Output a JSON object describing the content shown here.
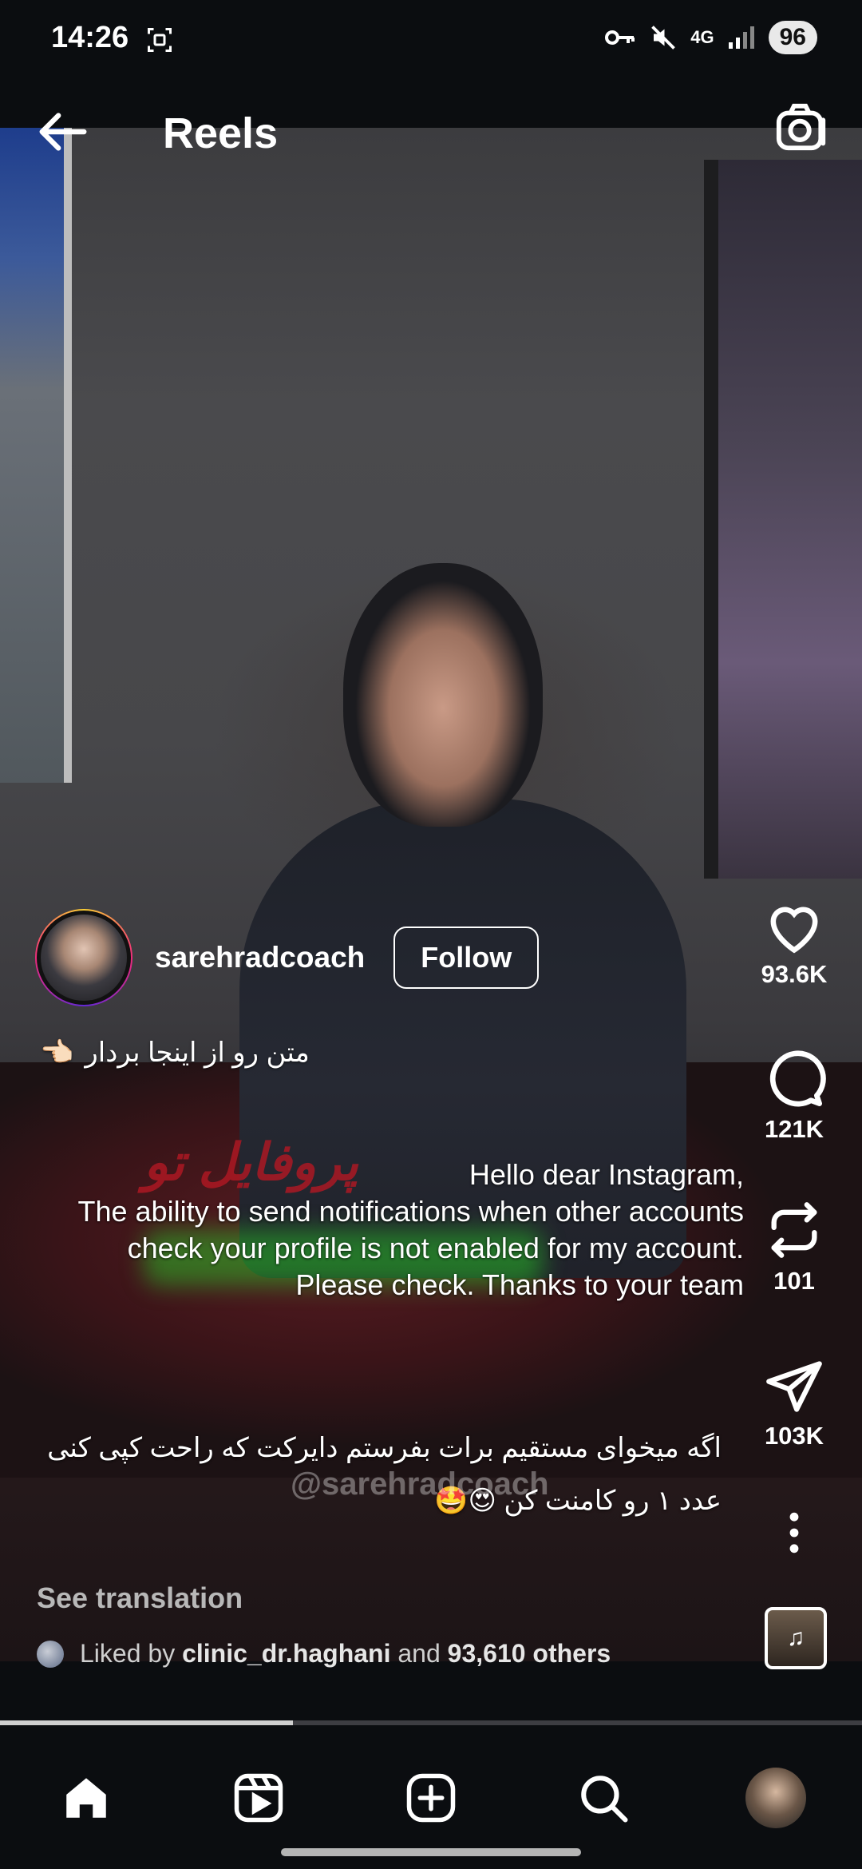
{
  "status_bar": {
    "time": "14:26",
    "network": "4G",
    "battery": "96"
  },
  "header": {
    "title": "Reels"
  },
  "reel": {
    "username": "sarehradcoach",
    "follow_label": "Follow",
    "caption_short": "متن رو از اینجا بردار",
    "caption_pointing_emoji": "👈🏻",
    "overlay_lines": [
      "Hello dear Instagram,",
      "The ability to send notifications when other accounts check your profile is not enabled for my account.",
      "Please check. Thanks to your team"
    ],
    "watermark_red_text": "پروفایل تو",
    "watermark_handle": "@sarehradcoach",
    "caption_long_line1": "اگه میخوای مستقیم برات بفرستم دایرکت که راحت کپی کنی",
    "caption_long_line2": "عدد ۱ رو کامنت کن 😍🤩",
    "see_translation": "See translation",
    "liked_prefix": "Liked by",
    "liked_user": "clinic_dr.haghani",
    "liked_and": "and",
    "liked_others": "93,610 others",
    "progress_fraction": 0.34
  },
  "actions": {
    "likes": "93.6K",
    "comments": "121K",
    "reposts": "101",
    "shares": "103K"
  },
  "icons": {
    "back": "back-arrow-icon",
    "camera": "camera-icon",
    "like": "heart-icon",
    "comment": "comment-icon",
    "repost": "repost-icon",
    "share": "send-icon",
    "more": "more-vertical-icon",
    "audio": "music-icon",
    "nav": [
      "home-icon",
      "reels-icon",
      "create-icon",
      "search-icon",
      "profile-avatar"
    ]
  }
}
